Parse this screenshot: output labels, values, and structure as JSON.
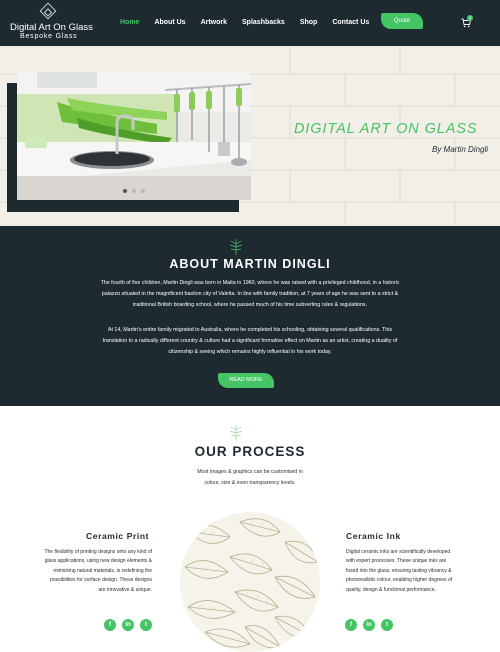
{
  "header": {
    "logo_title": "Digital Art On Glass",
    "logo_subtitle": "Bespoke Glass",
    "nav": [
      "Home",
      "About Us",
      "Artwork",
      "Splashbacks",
      "Shop",
      "Contact Us"
    ],
    "active_nav": "Home",
    "quote_label": "Quote",
    "cart_count": "0"
  },
  "hero": {
    "title": "DIGITAL ART ON GLASS",
    "byline": "By Martin Dingli",
    "slides_total": 3,
    "slide_active": 1
  },
  "about": {
    "title": "ABOUT MARTIN DINGLI",
    "paragraph1": "The fourth of five children, Martin Dingli was born in Malta in 1960, where he was raised with a privileged childhood, in a historic palazzo situated in the magnificent bastion city of Valetta. In line with family tradition, at 7 years of age he was sent to a strict & traditional British boarding school, where he passed much of his time subverting rules & regulations.",
    "paragraph2": "At 14, Martin's entire family migrated to Australia, where he completed his schooling, obtaining several qualifications. This translation to a radically different country & culture had a significant formative effect on Martin as an artist, creating a duality of citizenship & seeing which remains highly influential in his work today.",
    "button_label": "READ MORE"
  },
  "process": {
    "title": "OUR PROCESS",
    "subtitle": "Most images & graphics can be customised in colour, size & even transparency levels.",
    "left": {
      "title": "Ceramic Print",
      "text": "The flexibility of printing designs onto any kind of glass applications, using new design elements & mimicking natural materials, is redefining the possibilities for surface design. These designs are innovative & unique."
    },
    "right": {
      "title": "Ceramic Ink",
      "text": "Digital ceramic inks are scientifically developed with expert processes. These unique inks are fused into the glass, ensuring lasting vibrancy & photorealistic colour, enabling higher degrees of quality, design & functional performance."
    },
    "social_icons": [
      "f",
      "in",
      "t"
    ]
  },
  "colors": {
    "dark": "#1d2b31",
    "accent": "#45c465",
    "light_bg": "#f1ede7"
  }
}
